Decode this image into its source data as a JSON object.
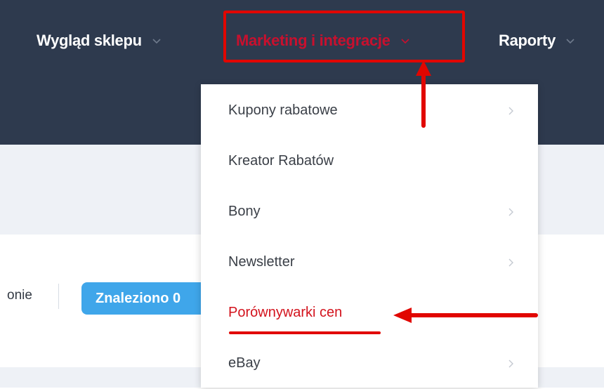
{
  "nav": {
    "items": [
      {
        "label": "Wygląd sklepu",
        "active": false
      },
      {
        "label": "Marketing i integracje",
        "active": true
      },
      {
        "label": "Raporty",
        "active": false
      }
    ],
    "chevron_icon": "chevron-down-icon"
  },
  "dropdown": {
    "items": [
      {
        "label": "Kupony rabatowe",
        "has_submenu": true
      },
      {
        "label": "Kreator Rabatów",
        "has_submenu": false
      },
      {
        "label": "Bony",
        "has_submenu": true
      },
      {
        "label": "Newsletter",
        "has_submenu": true
      },
      {
        "label": "Porównywarki cen",
        "has_submenu": false,
        "highlighted": true
      },
      {
        "label": "eBay",
        "has_submenu": true
      }
    ],
    "submenu_icon": "chevron-right-icon"
  },
  "content": {
    "toolbar_text": "onie",
    "found_badge": "Znaleziono 0"
  },
  "colors": {
    "nav_bg": "#2e3a4e",
    "annotation_red": "#e10600",
    "active_text": "#c8102e",
    "badge_bg": "#3fa6ea"
  }
}
